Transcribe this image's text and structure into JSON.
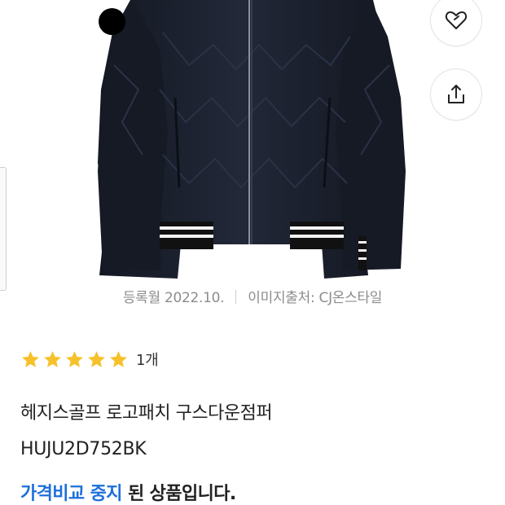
{
  "product": {
    "register_date": "등록월 2022.10.",
    "image_source": "이미지출처: CJ온스타일",
    "rating_count": "1개",
    "title": "헤지스골프 로고패치 구스다운점퍼",
    "model_code": "HUJU2D752BK",
    "status_highlight": "가격비교 중지",
    "status_rest": "된 상품입니다.",
    "color_swatch": "#000000"
  },
  "rating": {
    "stars": 5,
    "max": 5,
    "star_color": "#f6c12a"
  },
  "icons": {
    "wishlist": "heart-outline-icon",
    "share": "share-upload-icon"
  },
  "colors": {
    "accent_blue": "#1e6fd9",
    "meta_gray": "#8c8c8c",
    "jacket_navy": "#1b2030"
  }
}
